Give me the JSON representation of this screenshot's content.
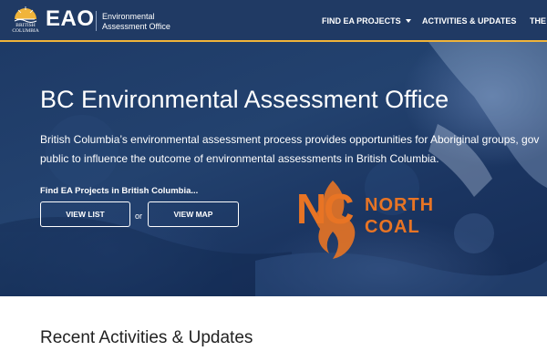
{
  "header": {
    "logo_text": "BRITISH COLUMBIA",
    "site_abbr": "EAO",
    "office_name": "Environmental Assessment Office",
    "nav": [
      {
        "label": "FIND EA PROJECTS",
        "has_dropdown": true
      },
      {
        "label": "ACTIVITIES & UPDATES"
      },
      {
        "label": "THE"
      }
    ]
  },
  "hero": {
    "title": "BC Environmental Assessment Office",
    "description_line1": "British Columbia’s environmental assessment process provides opportunities for Aboriginal groups, gov",
    "description_line2": "public to influence the outcome of environmental assessments in British Columbia.",
    "find_label": "Find EA Projects in British Columbia...",
    "view_list_label": "VIEW LIST",
    "or_text": "or",
    "view_map_label": "VIEW MAP"
  },
  "watermark": {
    "initials": "NC",
    "line1": "NORTH",
    "line2": "COAL"
  },
  "section": {
    "title": "Recent Activities & Updates"
  },
  "colors": {
    "header_bg": "#203a64",
    "header_border": "#f0b43a",
    "hero_bg": "#1e3a66",
    "watermark": "#e87424"
  },
  "icons": {
    "logo": "bc-sun-logo-icon",
    "dropdown": "caret-down-icon"
  }
}
